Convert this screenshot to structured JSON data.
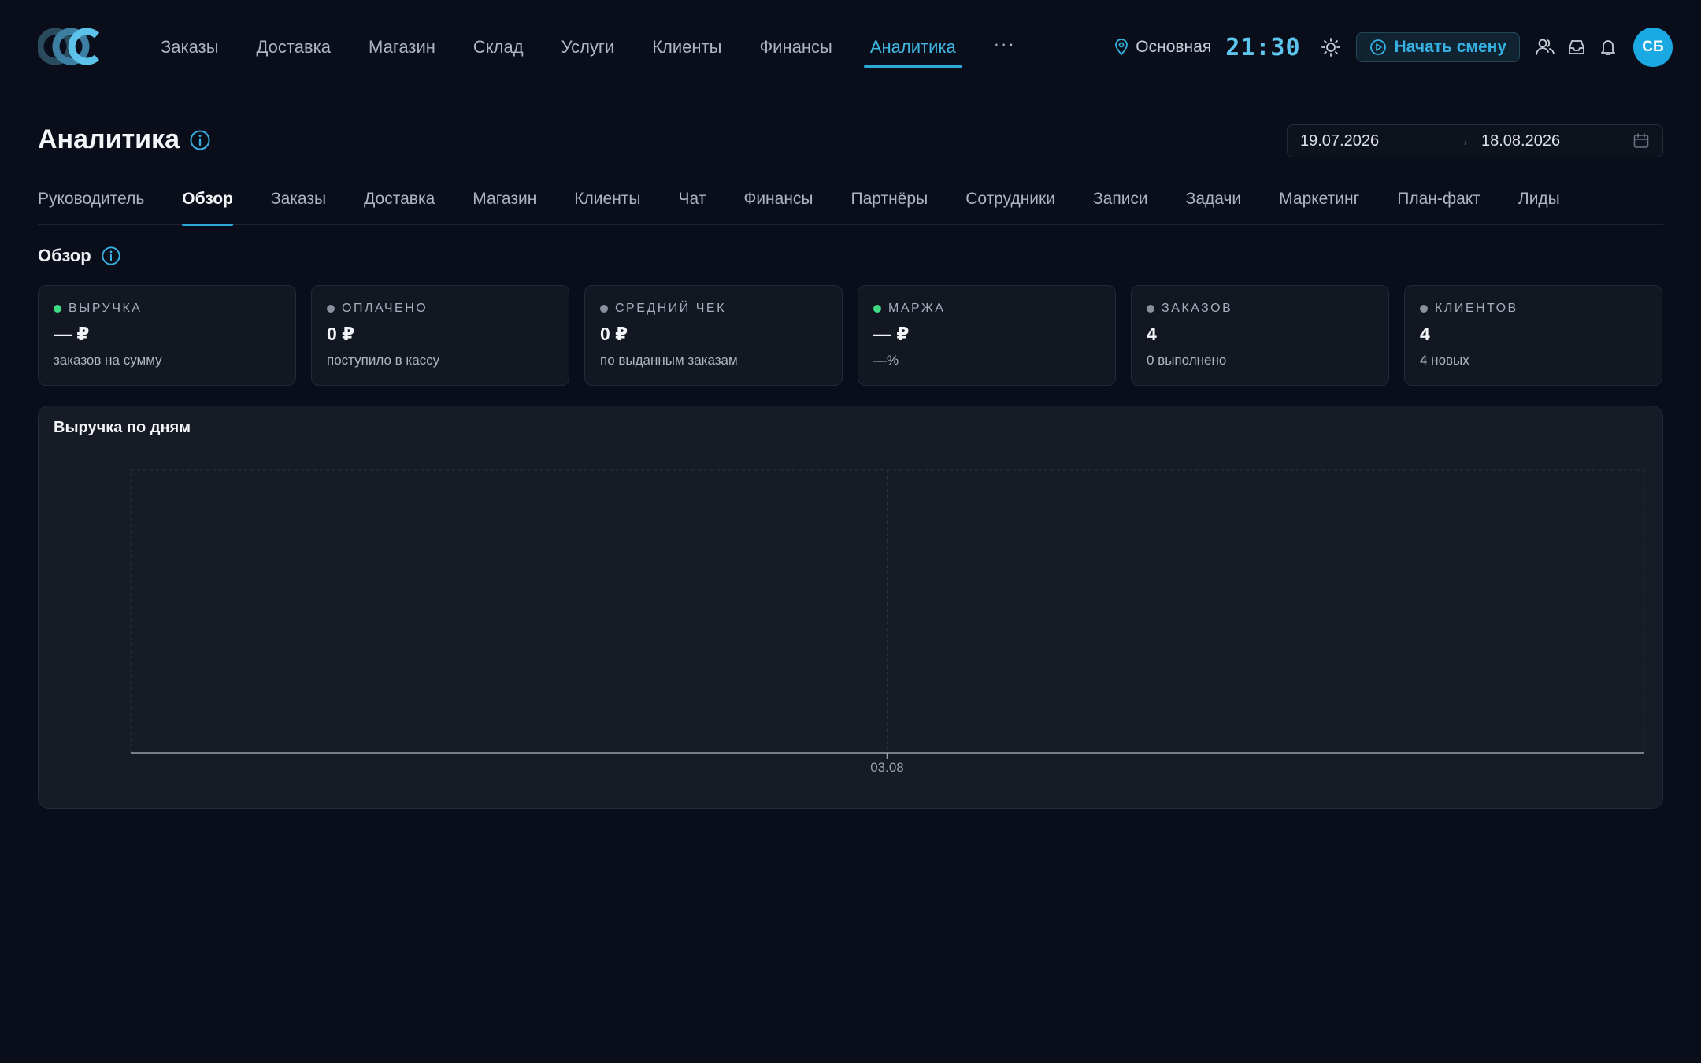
{
  "app": {
    "logo_name": "logo"
  },
  "topnav": {
    "items": [
      "Заказы",
      "Доставка",
      "Магазин",
      "Склад",
      "Услуги",
      "Клиенты",
      "Финансы",
      "Аналитика"
    ],
    "active": "Аналитика",
    "more_label": "···"
  },
  "topright": {
    "location": "Основная",
    "time": "21:30",
    "shift_button": "Начать смену",
    "avatar_initials": "СБ",
    "icons": [
      "map-pin-icon",
      "sun-icon",
      "play-circle-icon",
      "users-icon",
      "inbox-icon",
      "bell-icon"
    ]
  },
  "page": {
    "title": "Аналитика",
    "date_from": "19.07.2026",
    "date_arrow": "→",
    "date_to": "18.08.2026"
  },
  "subtabs": {
    "items": [
      "Руководитель",
      "Обзор",
      "Заказы",
      "Доставка",
      "Магазин",
      "Клиенты",
      "Чат",
      "Финансы",
      "Партнёры",
      "Сотрудники",
      "Записи",
      "Задачи",
      "Маркетинг",
      "План-факт",
      "Лиды"
    ],
    "active": "Обзор"
  },
  "section": {
    "title": "Обзор"
  },
  "cards": [
    {
      "label": "ВЫРУЧКА",
      "value": "— ₽",
      "sub": "заказов на сумму",
      "dot": "#3ddc84"
    },
    {
      "label": "ОПЛАЧЕНО",
      "value": "0 ₽",
      "sub": "поступило в кассу",
      "dot": "#8a909c"
    },
    {
      "label": "СРЕДНИЙ ЧЕК",
      "value": "0 ₽",
      "sub": "по выданным заказам",
      "dot": "#8a909c"
    },
    {
      "label": "МАРЖА",
      "value": "— ₽",
      "sub": "—%",
      "dot": "#3ddc84"
    },
    {
      "label": "ЗАКАЗОВ",
      "value": "4",
      "sub": "0 выполнено",
      "dot": "#8a909c"
    },
    {
      "label": "КЛИЕНТОВ",
      "value": "4",
      "sub": "4 новых",
      "dot": "#8a909c"
    }
  ],
  "chart_data": {
    "type": "line",
    "title": "Выручка по дням",
    "xlabel": "",
    "ylabel": "",
    "categories": [
      "03.08"
    ],
    "series": [],
    "grid": true
  },
  "colors": {
    "accent": "#2ea8d8",
    "background": "#0a0e1a",
    "positive": "#3ddc84"
  }
}
